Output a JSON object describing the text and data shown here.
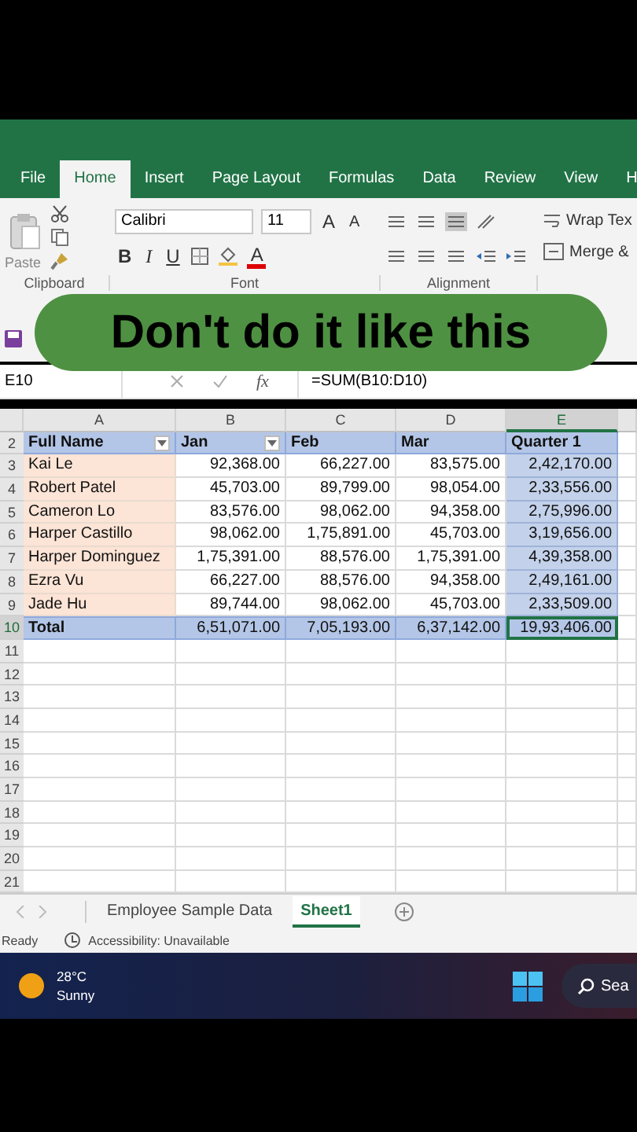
{
  "ribbon_tabs": [
    {
      "label": "File",
      "selected": false
    },
    {
      "label": "Home",
      "selected": true
    },
    {
      "label": "Insert",
      "selected": false
    },
    {
      "label": "Page Layout",
      "selected": false
    },
    {
      "label": "Formulas",
      "selected": false
    },
    {
      "label": "Data",
      "selected": false
    },
    {
      "label": "Review",
      "selected": false
    },
    {
      "label": "View",
      "selected": false
    },
    {
      "label": "H",
      "selected": false
    }
  ],
  "ribbon": {
    "clipboard": {
      "paste": "Paste",
      "group": "Clipboard"
    },
    "font": {
      "name": "Calibri",
      "size": "11",
      "grow": "A",
      "shrink": "A",
      "bold": "B",
      "italic": "I",
      "underline": "U",
      "font_color": "A",
      "group": "Font"
    },
    "alignment": {
      "wrap": "Wrap Tex",
      "merge": "Merge &",
      "group": "Alignment"
    }
  },
  "caption": "Don't do it like this",
  "formula_bar": {
    "name_box": "E10",
    "fx": "fx",
    "formula": "=SUM(B10:D10)"
  },
  "sheet": {
    "columns": [
      {
        "label": "A",
        "selected": false
      },
      {
        "label": "B",
        "selected": false
      },
      {
        "label": "C",
        "selected": false
      },
      {
        "label": "D",
        "selected": false
      },
      {
        "label": "E",
        "selected": true
      }
    ],
    "rows": [
      {
        "number": "2",
        "kind": "header",
        "selected": false,
        "cells": [
          "Full Name",
          "Jan",
          "Feb",
          "Mar",
          "Quarter 1"
        ]
      },
      {
        "number": "3",
        "kind": "data",
        "selected": false,
        "cells": [
          "Kai Le",
          "92,368.00",
          "66,227.00",
          "83,575.00",
          "2,42,170.00"
        ]
      },
      {
        "number": "4",
        "kind": "data",
        "selected": false,
        "cells": [
          "Robert Patel",
          "45,703.00",
          "89,799.00",
          "98,054.00",
          "2,33,556.00"
        ]
      },
      {
        "number": "5",
        "kind": "data",
        "selected": false,
        "cells": [
          "Cameron Lo",
          "83,576.00",
          "98,062.00",
          "94,358.00",
          "2,75,996.00"
        ]
      },
      {
        "number": "6",
        "kind": "data",
        "selected": false,
        "cells": [
          "Harper Castillo",
          "98,062.00",
          "1,75,891.00",
          "45,703.00",
          "3,19,656.00"
        ]
      },
      {
        "number": "7",
        "kind": "data",
        "selected": false,
        "cells": [
          "Harper Dominguez",
          "1,75,391.00",
          "88,576.00",
          "1,75,391.00",
          "4,39,358.00"
        ]
      },
      {
        "number": "8",
        "kind": "data",
        "selected": false,
        "cells": [
          "Ezra Vu",
          "66,227.00",
          "88,576.00",
          "94,358.00",
          "2,49,161.00"
        ]
      },
      {
        "number": "9",
        "kind": "data",
        "selected": false,
        "cells": [
          "Jade Hu",
          "89,744.00",
          "98,062.00",
          "45,703.00",
          "2,33,509.00"
        ]
      },
      {
        "number": "10",
        "kind": "total",
        "selected": true,
        "cells": [
          "Total",
          "6,51,071.00",
          "7,05,193.00",
          "6,37,142.00",
          "19,93,406.00"
        ]
      },
      {
        "number": "11",
        "kind": "empty",
        "selected": false,
        "cells": []
      },
      {
        "number": "12",
        "kind": "empty",
        "selected": false,
        "cells": []
      },
      {
        "number": "13",
        "kind": "empty",
        "selected": false,
        "cells": []
      },
      {
        "number": "14",
        "kind": "empty",
        "selected": false,
        "cells": []
      },
      {
        "number": "15",
        "kind": "empty",
        "selected": false,
        "cells": []
      },
      {
        "number": "16",
        "kind": "empty",
        "selected": false,
        "cells": []
      },
      {
        "number": "17",
        "kind": "empty",
        "selected": false,
        "cells": []
      },
      {
        "number": "18",
        "kind": "empty",
        "selected": false,
        "cells": []
      },
      {
        "number": "19",
        "kind": "empty",
        "selected": false,
        "cells": []
      },
      {
        "number": "20",
        "kind": "empty",
        "selected": false,
        "cells": []
      },
      {
        "number": "21",
        "kind": "empty",
        "selected": false,
        "cells": []
      }
    ]
  },
  "sheet_tabs": [
    {
      "label": "Employee Sample Data",
      "selected": false
    },
    {
      "label": "Sheet1",
      "selected": true
    }
  ],
  "status_bar": {
    "mode": "Ready",
    "accessibility": "Accessibility: Unavailable"
  },
  "taskbar": {
    "temperature": "28°C",
    "condition": "Sunny",
    "search": "Sea"
  }
}
